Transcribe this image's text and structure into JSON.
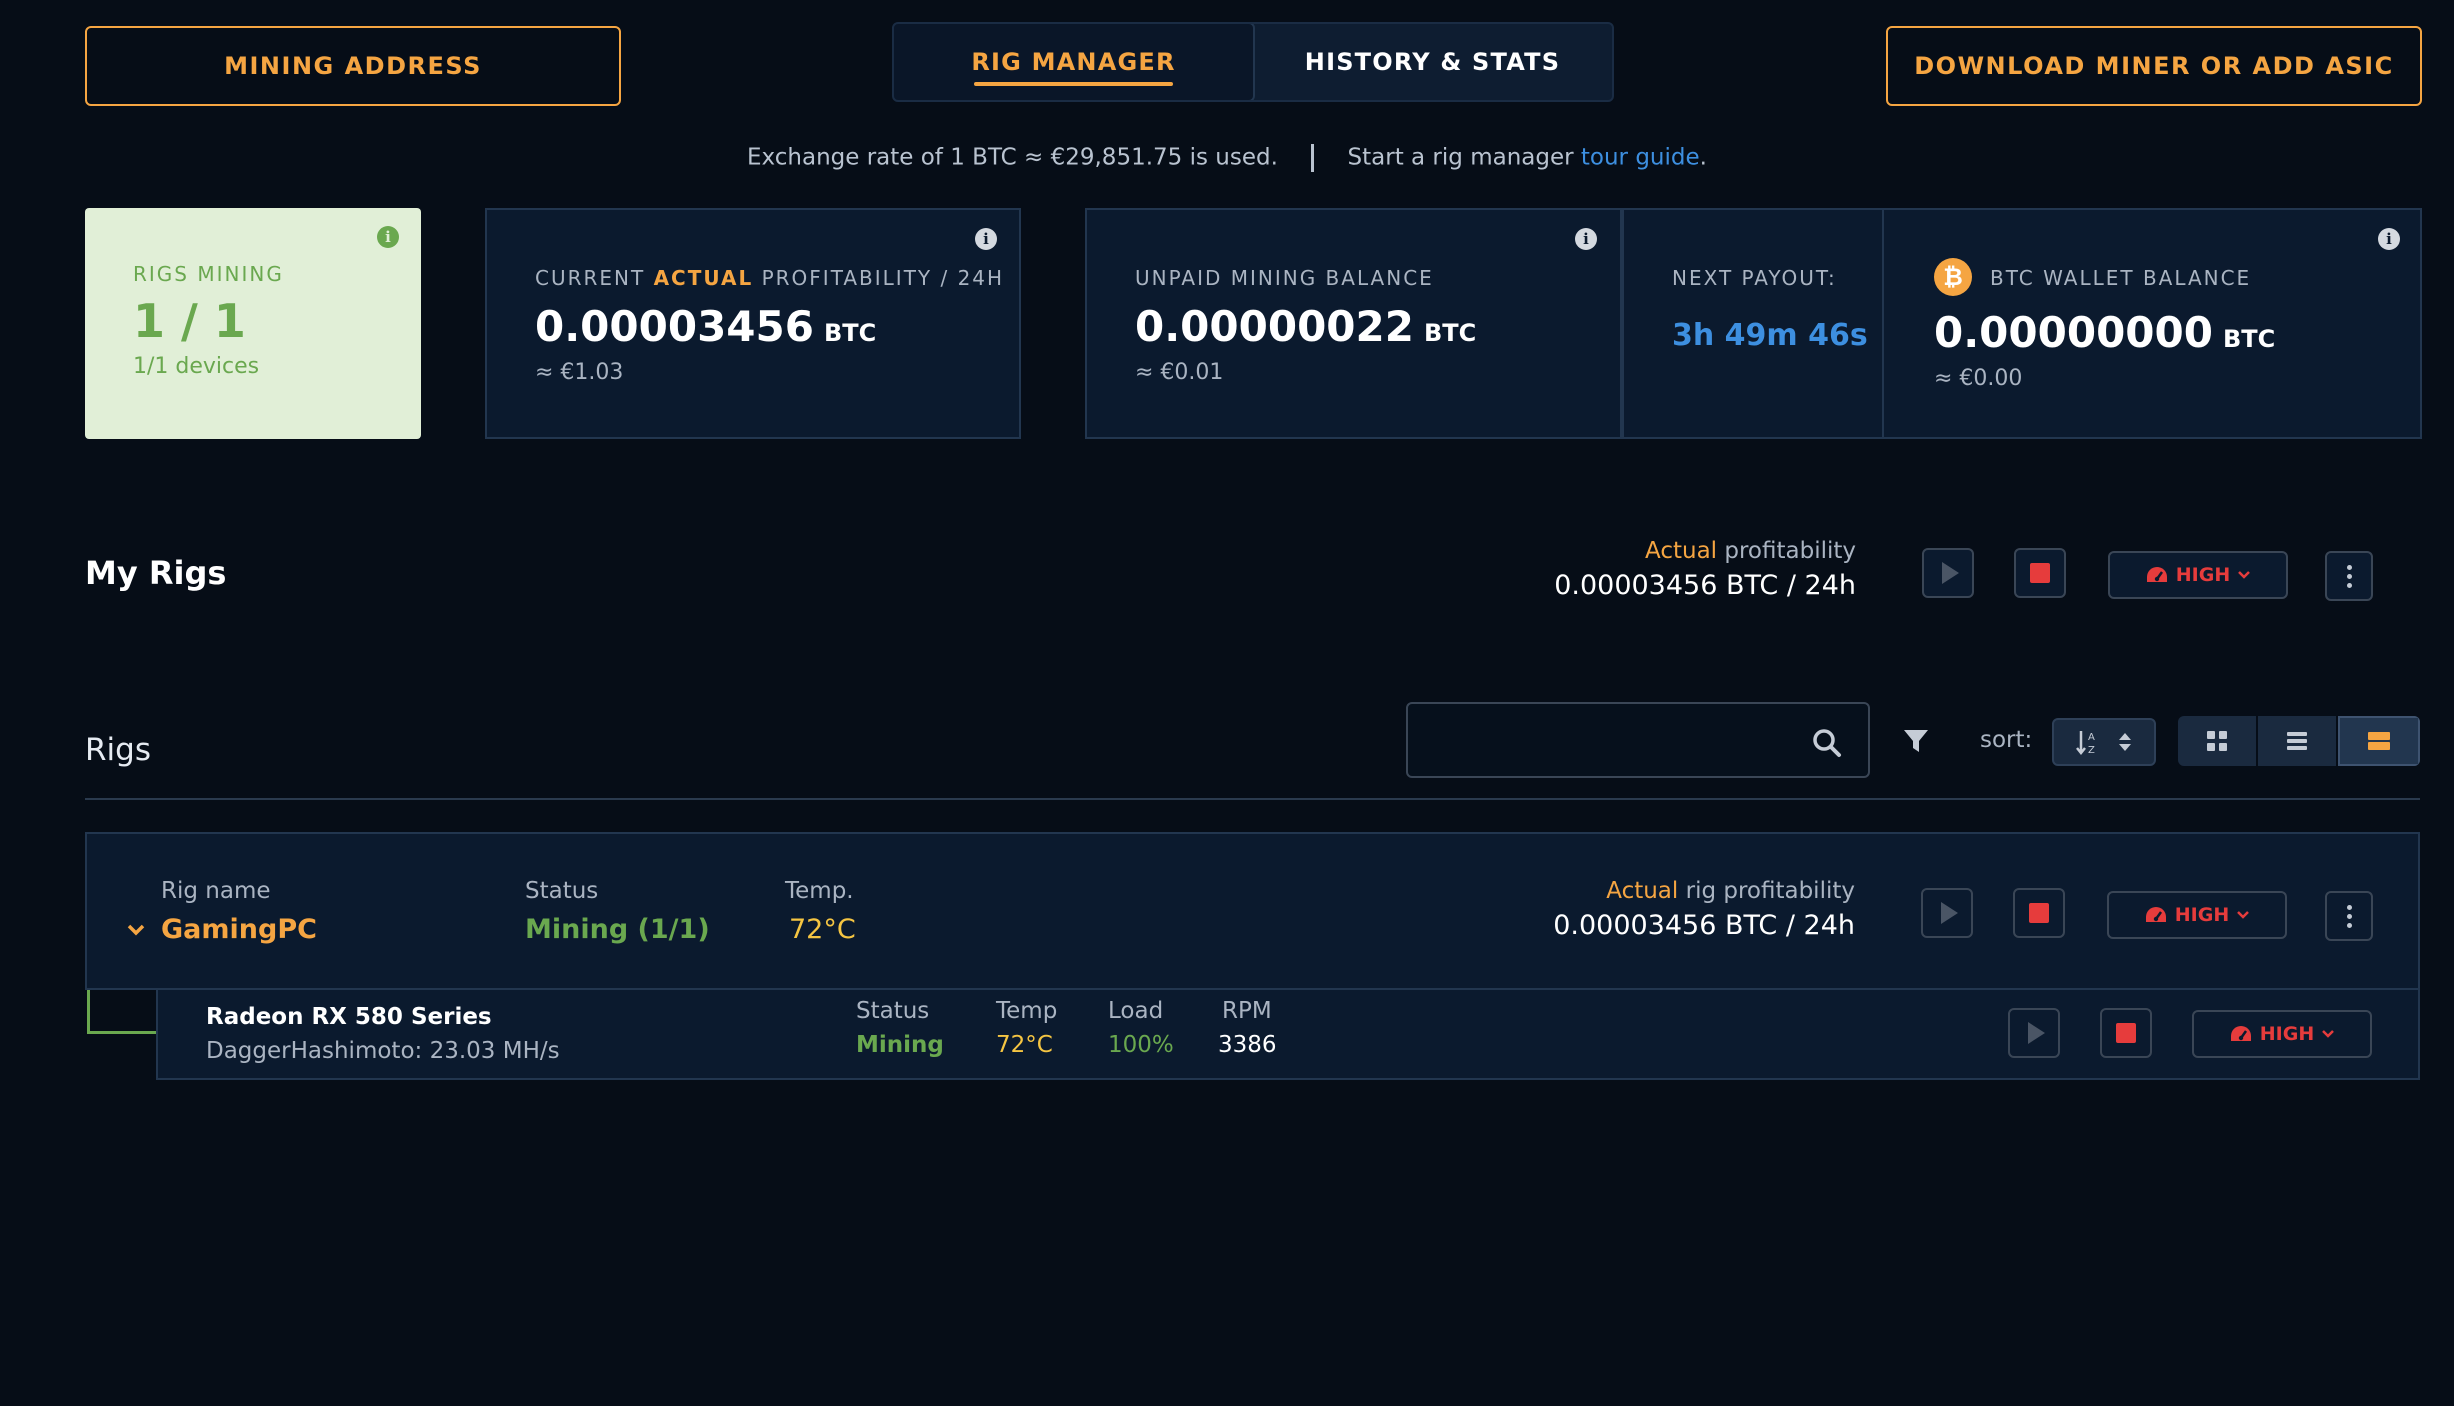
{
  "header": {
    "mining_address_label": "MINING ADDRESS",
    "download_label": "DOWNLOAD MINER OR ADD ASIC",
    "tabs": [
      {
        "label": "RIG MANAGER",
        "active": true
      },
      {
        "label": "HISTORY & STATS",
        "active": false
      }
    ]
  },
  "info_line": {
    "exchange_text": "Exchange rate of 1 BTC ≈ €29,851.75 is used.",
    "tour_prefix": "Start a rig manager ",
    "tour_link": "tour guide",
    "tour_suffix": "."
  },
  "stats": {
    "rigs_mining": {
      "label": "RIGS MINING",
      "value": "1 / 1",
      "sub": "1/1 devices"
    },
    "profitability": {
      "label_prefix": "CURRENT ",
      "label_accent": "ACTUAL",
      "label_suffix": " PROFITABILITY / 24H",
      "value": "0.00003456",
      "unit": "BTC",
      "sub": "≈ €1.03"
    },
    "unpaid": {
      "label": "UNPAID MINING BALANCE",
      "value": "0.00000022",
      "unit": "BTC",
      "sub": "≈ €0.01"
    },
    "next_payout": {
      "label": "NEXT PAYOUT:",
      "value": "3h 49m 46s"
    },
    "wallet": {
      "label": "BTC WALLET BALANCE",
      "value": "0.00000000",
      "unit": "BTC",
      "sub": "≈ €0.00",
      "coin_symbol": "₿"
    },
    "info_symbol": "i"
  },
  "my_rigs": {
    "title": "My Rigs",
    "profit_accent": "Actual",
    "profit_label": " profitability",
    "profit_value": "0.00003456 BTC / 24h",
    "power_label": "HIGH"
  },
  "rigs_section": {
    "title": "Rigs",
    "search_placeholder": "",
    "sort_label": "sort:"
  },
  "rig": {
    "name_label": "Rig name",
    "name": "GamingPC",
    "status_label": "Status",
    "status": "Mining (1/1)",
    "temp_label": "Temp.",
    "temp": "72°C",
    "profit_accent": "Actual",
    "profit_label": " rig profitability",
    "profit_value": "0.00003456 BTC / 24h",
    "power_label": "HIGH"
  },
  "device": {
    "name": "Radeon RX 580 Series",
    "algo": "DaggerHashimoto: 23.03 MH/s",
    "status_label": "Status",
    "status": "Mining",
    "temp_label": "Temp",
    "temp": "72°C",
    "load_label": "Load",
    "load": "100%",
    "rpm_label": "RPM",
    "rpm": "3386",
    "power_label": "HIGH"
  },
  "colors": {
    "accent": "#f5a542",
    "green": "#6aa84f",
    "blue": "#3d8fe0",
    "red": "#e63c3c",
    "bg": "#060d17"
  }
}
